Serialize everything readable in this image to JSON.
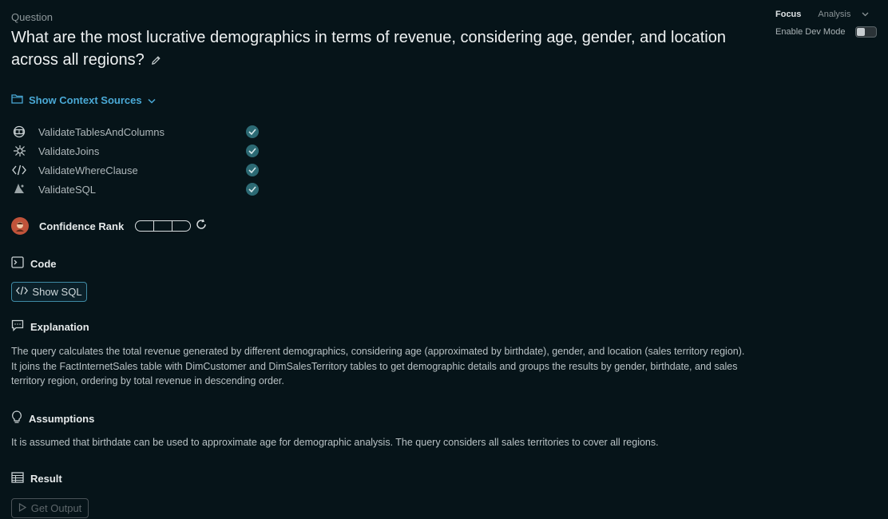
{
  "question": {
    "label": "Question",
    "text": "What are the most lucrative demographics in terms of revenue, considering age, gender, and location across all regions?"
  },
  "context": {
    "toggle_label": "Show Context Sources"
  },
  "validations": [
    {
      "name": "ValidateTablesAndColumns",
      "icon": "tables-icon",
      "status": "passed"
    },
    {
      "name": "ValidateJoins",
      "icon": "joins-icon",
      "status": "passed"
    },
    {
      "name": "ValidateWhereClause",
      "icon": "code-icon",
      "status": "passed"
    },
    {
      "name": "ValidateSQL",
      "icon": "sql-icon",
      "status": "passed"
    }
  ],
  "confidence": {
    "label": "Confidence Rank",
    "segments": 3
  },
  "code": {
    "title": "Code",
    "show_sql_label": "Show SQL"
  },
  "explanation": {
    "title": "Explanation",
    "text": "The query calculates the total revenue generated by different demographics, considering age (approximated by birthdate), gender, and location (sales territory region). It joins the FactInternetSales table with DimCustomer and DimSalesTerritory tables to get demographic details and groups the results by gender, birthdate, and sales territory region, ordering by total revenue in descending order."
  },
  "assumptions": {
    "title": "Assumptions",
    "text": "It is assumed that birthdate can be used to approximate age for demographic analysis. The query considers all sales territories to cover all regions."
  },
  "result": {
    "title": "Result",
    "get_output_label": "Get Output"
  },
  "top_right": {
    "mode_focus": "Focus",
    "mode_analysis": "Analysis",
    "dev_mode_label": "Enable Dev Mode",
    "dev_mode_enabled": false
  },
  "colors": {
    "background": "#061419",
    "accent": "#4aa9d6",
    "check": "#2c6a74"
  }
}
